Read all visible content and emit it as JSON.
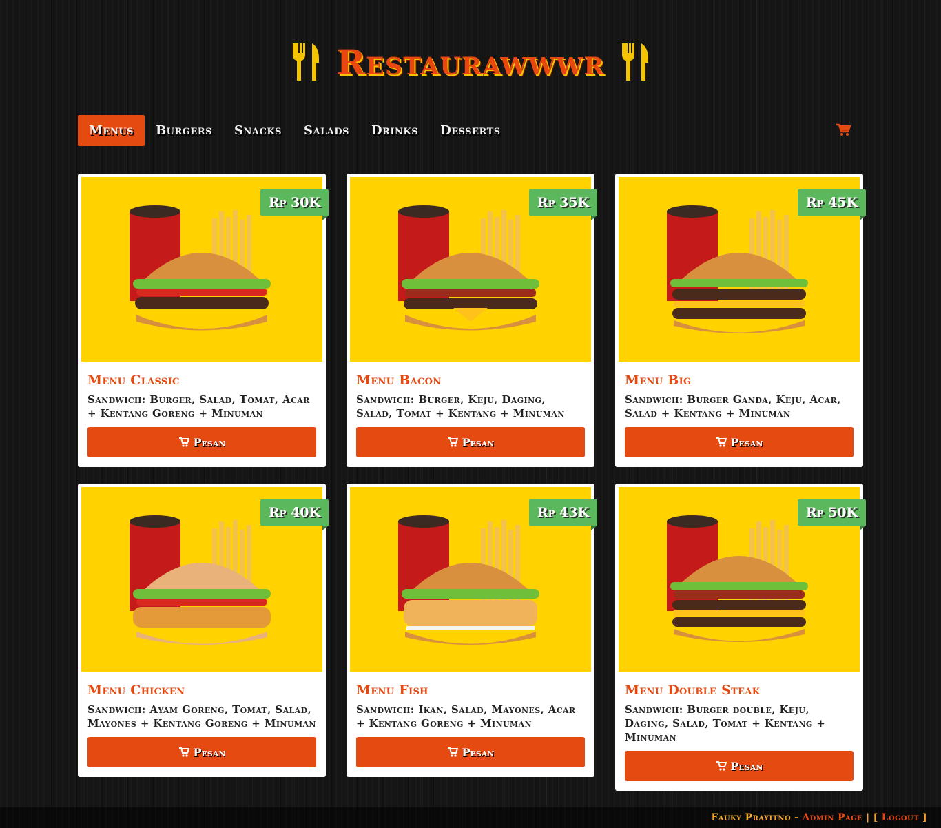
{
  "site": {
    "title": "Restaurawwwr"
  },
  "nav": {
    "items": [
      {
        "label": "Menus",
        "active": true
      },
      {
        "label": "Burgers"
      },
      {
        "label": "Snacks"
      },
      {
        "label": "Salads"
      },
      {
        "label": "Drinks"
      },
      {
        "label": "Desserts"
      }
    ],
    "cart_icon": "cart-icon"
  },
  "colors": {
    "accent": "#e54a11",
    "price_badge": "#5cb85c",
    "image_bg": "#ffd200"
  },
  "menu": [
    {
      "title": "Menu Classic",
      "price": "Rp 30K",
      "desc": "Sandwich: Burger, Salad, Tomat, Acar + Kentang Goreng + Minuman",
      "button": "Pesan"
    },
    {
      "title": "Menu Bacon",
      "price": "Rp 35K",
      "desc": "Sandwich: Burger, Keju, Daging, Salad, Tomat + Kentang + Minuman",
      "button": "Pesan"
    },
    {
      "title": "Menu Big",
      "price": "Rp 45K",
      "desc": "Sandwich: Burger Ganda, Keju, Acar, Salad + Kentang + Minuman",
      "button": "Pesan"
    },
    {
      "title": "Menu Chicken",
      "price": "Rp 40K",
      "desc": "Sandwich: Ayam Goreng, Tomat, Salad, Mayones + Kentang Goreng + Minuman",
      "button": "Pesan"
    },
    {
      "title": "Menu Fish",
      "price": "Rp 43K",
      "desc": "Sandwich: Ikan, Salad, Mayones, Acar + Kentang Goreng + Minuman",
      "button": "Pesan"
    },
    {
      "title": "Menu Double Steak",
      "price": "Rp 50K",
      "desc": "Sandwich: Burger double, Keju, Daging, Salad, Tomat + Kentang + Minuman",
      "button": "Pesan"
    }
  ],
  "footer": {
    "user": "Fauky Prayitno",
    "dash": "-",
    "admin_link": "Admin Page",
    "divider": "|",
    "bracket_open": "[",
    "logout_link": "Logout",
    "bracket_close": "]"
  }
}
